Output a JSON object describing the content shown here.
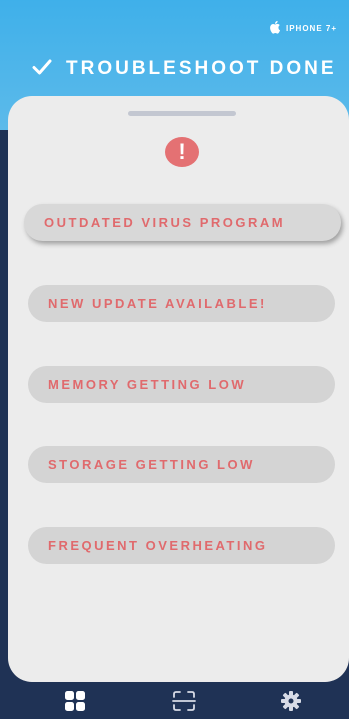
{
  "device": {
    "label": "IPHONE 7+",
    "icon": "apple-icon"
  },
  "header": {
    "title": "TROUBLESHOOT DONE",
    "icon": "checkmark-icon"
  },
  "alert": {
    "symbol": "!",
    "icon": "alert-icon"
  },
  "issues": [
    {
      "label": "OUTDATED VIRUS PROGRAM"
    },
    {
      "label": "NEW UPDATE AVAILABLE!"
    },
    {
      "label": "MEMORY GETTING LOW"
    },
    {
      "label": "STORAGE GETTING LOW"
    },
    {
      "label": "FREQUENT OVERHEATING"
    }
  ],
  "tabs": [
    {
      "icon": "dashboard-icon",
      "selected": true
    },
    {
      "icon": "scan-icon",
      "selected": false
    },
    {
      "icon": "settings-gear-icon",
      "selected": false
    }
  ],
  "colors": {
    "header_gradient_top": "#3fb0ea",
    "header_gradient_bottom": "#5cbaea",
    "tabbar": "#1f3255",
    "issue_text": "#e06a6d",
    "alert": "#e47173"
  }
}
